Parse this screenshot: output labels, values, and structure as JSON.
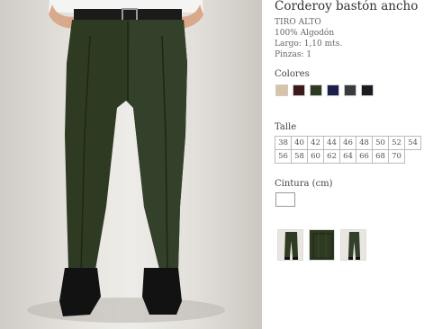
{
  "product": {
    "title": "Corderoy bastón ancho",
    "specs": [
      "TIRO ALTO",
      "100% Algodón",
      "Largo: 1,10 mts.",
      "Pinzas: 1"
    ]
  },
  "colors": {
    "label": "Colores",
    "swatches": [
      "#d8c3a5",
      "#3a1a1a",
      "#2c3a22",
      "#1c1f4a",
      "#3a3b3f",
      "#1a1c22"
    ]
  },
  "sizes": {
    "label": "Talle",
    "rows": [
      [
        "38",
        "40",
        "42",
        "44",
        "46",
        "48",
        "50",
        "52",
        "54"
      ],
      [
        "56",
        "58",
        "60",
        "62",
        "64",
        "66",
        "68",
        "70"
      ]
    ]
  },
  "waist": {
    "label": "Cintura (cm)"
  },
  "colors_accent": {
    "pants": "#2e3a22",
    "belt": "#1b1b1b",
    "shirt": "#f4f4f2"
  }
}
